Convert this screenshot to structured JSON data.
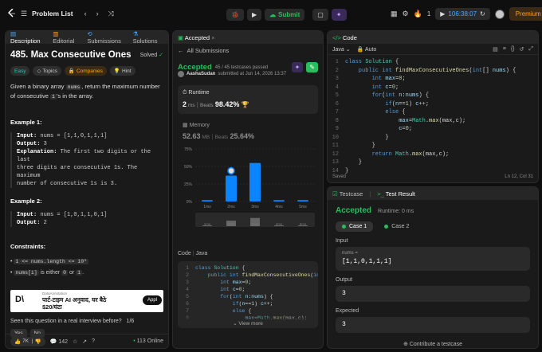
{
  "topbar": {
    "problem_list": "Problem List",
    "submit": "Submit",
    "timer": "106:38:07",
    "count": "1",
    "premium": "Premium"
  },
  "desc": {
    "tabs": [
      "Description",
      "Editorial",
      "Submissions",
      "Solutions"
    ],
    "title": "485. Max Consecutive Ones",
    "solved": "Solved",
    "tags": [
      "Easy",
      "Topics",
      "Companies",
      "Hint"
    ],
    "stmt1": "Given a binary array ",
    "stmt_code": "nums",
    "stmt2": ", return the maximum number of consecutive ",
    "stmt_code2": "1",
    "stmt3": "'s in the array.",
    "ex1_title": "Example 1:",
    "ex1_input_label": "Input:",
    "ex1_input": " nums = [1,1,0,1,1,1]",
    "ex1_output_label": "Output:",
    "ex1_output": " 3",
    "ex1_expl_label": "Explanation:",
    "ex1_expl1": " The first two digits or the last",
    "ex1_expl2": "three digits are consecutive 1s. The maximum",
    "ex1_expl3": "number of consecutive 1s is 3.",
    "ex2_title": "Example 2:",
    "ex2_input_label": "Input:",
    "ex2_input": " nums = [1,0,1,1,0,1]",
    "ex2_output_label": "Output:",
    "ex2_output": " 2",
    "constraints_title": "Constraints:",
    "c1": "1 <= nums.length <= 10⁵",
    "c2a": "nums[i]",
    "c2b": " is either ",
    "c2c": "0",
    "c2d": " or ",
    "c2e": "1",
    "c2f": ".",
    "ad_label": "DataAnnotation",
    "ad_text1": "पार्ट-टाइम AI अनुवाद, घर बैठे",
    "ad_text2": "$20/घंटा",
    "ad_btn": "Appl",
    "question": "Seen this question in a real interview before?",
    "question_count": "1/6",
    "yes": "Yes",
    "no": "No",
    "likes": "7K",
    "comments": "142",
    "online": "113 Online"
  },
  "sub": {
    "tab": "Accepted",
    "all": "All Submissions",
    "status": "Accepted",
    "passed": "45 / 45 testcases passed",
    "user": "AashaSudan",
    "submitted": " submitted at Jun 14, 2026 13:37",
    "runtime_label": "Runtime",
    "runtime": "2",
    "runtime_unit": " ms",
    "beats_label": "Beats",
    "beats": "98.42%",
    "memory_label": "Memory",
    "memory": "52.63",
    "memory_unit": " MB",
    "mem_beats_label": "Beats",
    "mem_beats": "25.64%",
    "code_label": "Code",
    "lang": "Java",
    "view_more": "View more"
  },
  "chart_data": {
    "type": "bar",
    "categories": [
      "1ms",
      "2ms",
      "3ms",
      "4ms",
      "5ms"
    ],
    "values": [
      2,
      37,
      55,
      2,
      2
    ],
    "ylim": [
      0,
      75
    ],
    "yticks": [
      "75%",
      "50%",
      "25%",
      "0%"
    ],
    "highlight": "2ms"
  },
  "editor": {
    "title": "Code",
    "lang": "Java",
    "mode": "Auto",
    "status": "Saved",
    "cursor": "Ln 12, Col 31"
  },
  "test": {
    "tab1": "Testcase",
    "tab2": "Test Result",
    "status": "Accepted",
    "runtime": "Runtime: 0 ms",
    "case1": "Case 1",
    "case2": "Case 2",
    "input_label": "Input",
    "nums_label": "nums =",
    "nums_value": "[1,1,0,1,1,1]",
    "output_label": "Output",
    "output": "3",
    "expected_label": "Expected",
    "expected": "3",
    "contribute": "Contribute a testcase"
  },
  "colors": {
    "accent": "#2cbb5d",
    "brand": "#ffa116",
    "bar": "#0a84ff"
  }
}
